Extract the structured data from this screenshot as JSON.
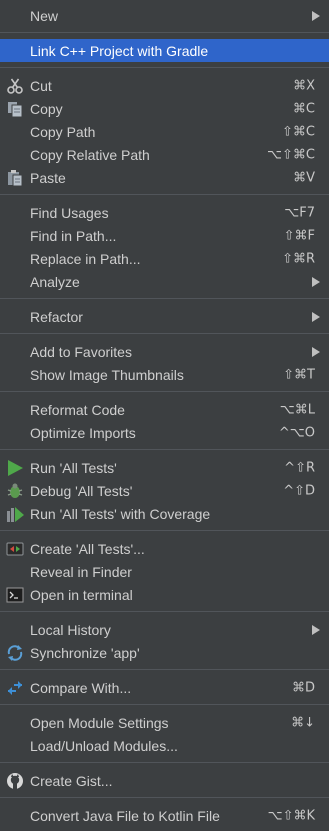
{
  "menu": {
    "new": {
      "label": "New"
    },
    "link_cpp": {
      "label": "Link C++ Project with Gradle"
    },
    "cut": {
      "label": "Cut",
      "shortcut": "⌘X"
    },
    "copy": {
      "label": "Copy",
      "shortcut": "⌘C"
    },
    "copy_path": {
      "label": "Copy Path",
      "shortcut": "⇧⌘C"
    },
    "copy_relative_path": {
      "label": "Copy Relative Path",
      "shortcut": "⌥⇧⌘C"
    },
    "paste": {
      "label": "Paste",
      "shortcut": "⌘V"
    },
    "find_usages": {
      "label": "Find Usages",
      "shortcut": "⌥F7"
    },
    "find_in_path": {
      "label": "Find in Path...",
      "shortcut": "⇧⌘F"
    },
    "replace_in_path": {
      "label": "Replace in Path...",
      "shortcut": "⇧⌘R"
    },
    "analyze": {
      "label": "Analyze"
    },
    "refactor": {
      "label": "Refactor"
    },
    "add_to_favorites": {
      "label": "Add to Favorites"
    },
    "show_image_thumbnails": {
      "label": "Show Image Thumbnails",
      "shortcut": "⇧⌘T"
    },
    "reformat_code": {
      "label": "Reformat Code",
      "shortcut": "⌥⌘L"
    },
    "optimize_imports": {
      "label": "Optimize Imports",
      "shortcut": "^⌥O"
    },
    "run_all_tests": {
      "label": "Run 'All Tests'",
      "shortcut": "^⇧R"
    },
    "debug_all_tests": {
      "label": "Debug 'All Tests'",
      "shortcut": "^⇧D"
    },
    "run_with_coverage": {
      "label": "Run 'All Tests' with Coverage"
    },
    "create_all_tests": {
      "label": "Create 'All Tests'..."
    },
    "reveal_in_finder": {
      "label": "Reveal in Finder"
    },
    "open_in_terminal": {
      "label": "Open in terminal"
    },
    "local_history": {
      "label": "Local History"
    },
    "synchronize": {
      "label": "Synchronize 'app'"
    },
    "compare_with": {
      "label": "Compare With...",
      "shortcut": "⌘D"
    },
    "open_module_settings": {
      "label": "Open Module Settings",
      "shortcut": "⌘↓"
    },
    "load_unload_modules": {
      "label": "Load/Unload Modules..."
    },
    "create_gist": {
      "label": "Create Gist..."
    },
    "convert_java_to_kotlin": {
      "label": "Convert Java File to Kotlin File",
      "shortcut": "⌥⇧⌘K"
    }
  },
  "colors": {
    "background": "#3c3f41",
    "selection": "#2f65ca",
    "separator": "#51555a",
    "text": "#cfcfcf",
    "run_green": "#4fa84a",
    "compare_blue": "#3d8fd6"
  }
}
